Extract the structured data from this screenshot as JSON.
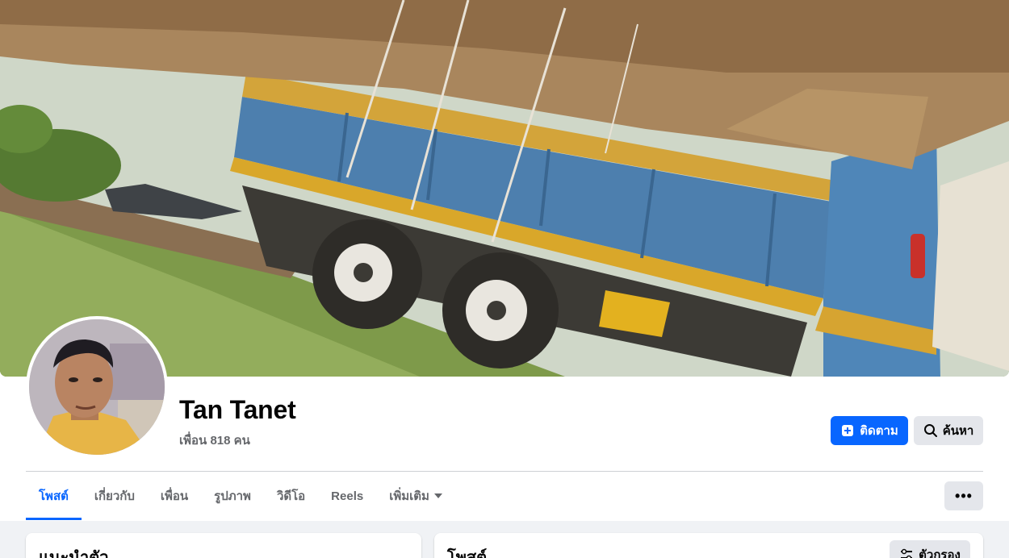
{
  "profile": {
    "name": "Tan Tanet",
    "friends_text": "เพื่อน 818 คน"
  },
  "actions": {
    "follow_label": "ติดตาม",
    "search_label": "ค้นหา",
    "more_label": "•••"
  },
  "tabs": [
    {
      "label": "โพสต์",
      "active": true
    },
    {
      "label": "เกี่ยวกับ",
      "active": false
    },
    {
      "label": "เพื่อน",
      "active": false
    },
    {
      "label": "รูปภาพ",
      "active": false
    },
    {
      "label": "วิดีโอ",
      "active": false
    },
    {
      "label": "Reels",
      "active": false
    },
    {
      "label": "เพิ่มเติม",
      "active": false,
      "dropdown": true
    }
  ],
  "intro_card": {
    "title": "แนะนำตัว"
  },
  "posts_card": {
    "title": "โพสต์",
    "filter_label": "ตัวกรอง"
  },
  "colors": {
    "accent": "#0866ff",
    "secondary_text": "#65676b",
    "button_gray": "#e4e6eb",
    "page_bg": "#f0f2f5"
  },
  "icons": {
    "follow": "follow-plus-icon",
    "search": "search-icon",
    "more": "more-dots-icon",
    "tab_dropdown": "caret-down-icon",
    "filter": "filter-sliders-icon"
  }
}
